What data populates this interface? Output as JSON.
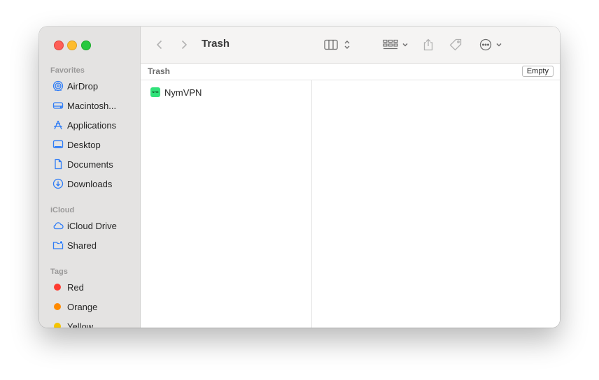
{
  "window": {
    "title": "Trash"
  },
  "sidebar": {
    "sections": {
      "favorites": "Favorites",
      "icloud": "iCloud",
      "tags": "Tags"
    },
    "favorites": [
      {
        "label": "AirDrop",
        "icon": "airdrop-icon"
      },
      {
        "label": "Macintosh...",
        "icon": "hard-drive-icon"
      },
      {
        "label": "Applications",
        "icon": "applications-icon"
      },
      {
        "label": "Desktop",
        "icon": "desktop-icon"
      },
      {
        "label": "Documents",
        "icon": "document-icon"
      },
      {
        "label": "Downloads",
        "icon": "download-icon"
      }
    ],
    "icloud": [
      {
        "label": "iCloud Drive",
        "icon": "cloud-icon"
      },
      {
        "label": "Shared",
        "icon": "shared-folder-icon"
      }
    ],
    "tags": [
      {
        "label": "Red",
        "color": "#fe3b30"
      },
      {
        "label": "Orange",
        "color": "#ff8a00"
      },
      {
        "label": "Yellow",
        "color": "#f5c400"
      }
    ]
  },
  "pathbar": {
    "label": "Trash",
    "empty_button": "Empty"
  },
  "files": [
    {
      "name": "NymVPN",
      "icon_text": "NYM"
    }
  ],
  "colors": {
    "accent": "#2e7cf6"
  }
}
